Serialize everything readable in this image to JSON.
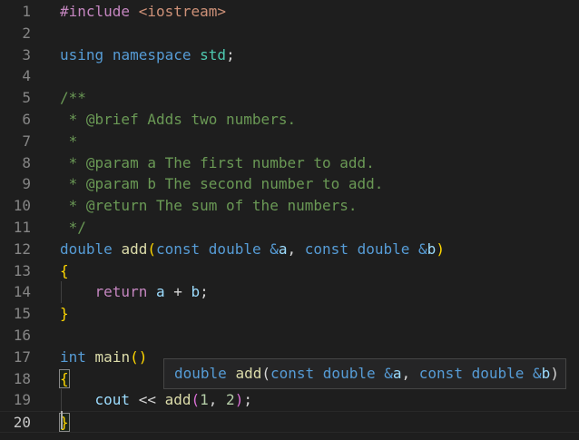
{
  "editor": {
    "lines": [
      {
        "n": "1",
        "tokens": [
          [
            "pre",
            "#include"
          ],
          [
            "plain",
            " "
          ],
          [
            "inc",
            "<iostream>"
          ]
        ]
      },
      {
        "n": "2",
        "tokens": []
      },
      {
        "n": "3",
        "tokens": [
          [
            "kw",
            "using"
          ],
          [
            "plain",
            " "
          ],
          [
            "kw",
            "namespace"
          ],
          [
            "plain",
            " "
          ],
          [
            "ns",
            "std"
          ],
          [
            "plain",
            ";"
          ]
        ]
      },
      {
        "n": "4",
        "tokens": []
      },
      {
        "n": "5",
        "tokens": [
          [
            "cm",
            "/**"
          ]
        ]
      },
      {
        "n": "6",
        "tokens": [
          [
            "cm",
            " * @brief Adds two numbers."
          ]
        ]
      },
      {
        "n": "7",
        "tokens": [
          [
            "cm",
            " *"
          ]
        ]
      },
      {
        "n": "8",
        "tokens": [
          [
            "cm",
            " * @param a The first number to add."
          ]
        ]
      },
      {
        "n": "9",
        "tokens": [
          [
            "cm",
            " * @param b The second number to add."
          ]
        ]
      },
      {
        "n": "10",
        "tokens": [
          [
            "cm",
            " * @return The sum of the numbers."
          ]
        ]
      },
      {
        "n": "11",
        "tokens": [
          [
            "cm",
            " */"
          ]
        ]
      },
      {
        "n": "12",
        "tokens": [
          [
            "kw",
            "double"
          ],
          [
            "plain",
            " "
          ],
          [
            "fn",
            "add"
          ],
          [
            "br1",
            "("
          ],
          [
            "kw",
            "const"
          ],
          [
            "plain",
            " "
          ],
          [
            "kw",
            "double"
          ],
          [
            "plain",
            " "
          ],
          [
            "kw",
            "&"
          ],
          [
            "var",
            "a"
          ],
          [
            "plain",
            ", "
          ],
          [
            "kw",
            "const"
          ],
          [
            "plain",
            " "
          ],
          [
            "kw",
            "double"
          ],
          [
            "plain",
            " "
          ],
          [
            "kw",
            "&"
          ],
          [
            "var",
            "b"
          ],
          [
            "br1",
            ")"
          ]
        ]
      },
      {
        "n": "13",
        "tokens": [
          [
            "br1",
            "{"
          ]
        ]
      },
      {
        "n": "14",
        "tokens": [
          [
            "plain",
            "    "
          ],
          [
            "ctrl",
            "return"
          ],
          [
            "plain",
            " "
          ],
          [
            "var",
            "a"
          ],
          [
            "plain",
            " + "
          ],
          [
            "var",
            "b"
          ],
          [
            "plain",
            ";"
          ]
        ]
      },
      {
        "n": "15",
        "tokens": [
          [
            "br1",
            "}"
          ]
        ]
      },
      {
        "n": "16",
        "tokens": []
      },
      {
        "n": "17",
        "tokens": [
          [
            "kw",
            "int"
          ],
          [
            "plain",
            " "
          ],
          [
            "fn",
            "main"
          ],
          [
            "br1",
            "()"
          ]
        ]
      },
      {
        "n": "18",
        "tokens": [
          [
            "br1m",
            "{"
          ]
        ]
      },
      {
        "n": "19",
        "tokens": [
          [
            "plain",
            "    "
          ],
          [
            "var",
            "cout"
          ],
          [
            "plain",
            " << "
          ],
          [
            "fn",
            "add"
          ],
          [
            "br2",
            "("
          ],
          [
            "num",
            "1"
          ],
          [
            "plain",
            ", "
          ],
          [
            "num",
            "2"
          ],
          [
            "br2",
            ")"
          ],
          [
            "plain",
            ";"
          ]
        ]
      },
      {
        "n": "20",
        "tokens": [
          [
            "br1m",
            "}"
          ]
        ]
      }
    ],
    "active_line": "20"
  },
  "hover": {
    "tokens": [
      [
        "kw",
        "double"
      ],
      [
        "plain",
        " "
      ],
      [
        "fn",
        "add"
      ],
      [
        "plain",
        "("
      ],
      [
        "kw",
        "const"
      ],
      [
        "plain",
        " "
      ],
      [
        "kw",
        "double"
      ],
      [
        "plain",
        " "
      ],
      [
        "kw",
        "&"
      ],
      [
        "var",
        "a"
      ],
      [
        "plain",
        ", "
      ],
      [
        "kw",
        "const"
      ],
      [
        "plain",
        " "
      ],
      [
        "kw",
        "double"
      ],
      [
        "plain",
        " "
      ],
      [
        "kw",
        "&"
      ],
      [
        "var",
        "b"
      ],
      [
        "plain",
        ")"
      ]
    ]
  },
  "colors": {
    "background": "#1e1e1e",
    "keyword": "#569cd6",
    "function": "#dcdcaa",
    "variable": "#9cdcfe",
    "comment": "#6a9955",
    "string": "#ce9178",
    "number": "#b5cea8",
    "bracket": "#ffd700",
    "bracket_nested": "#da70d6"
  }
}
